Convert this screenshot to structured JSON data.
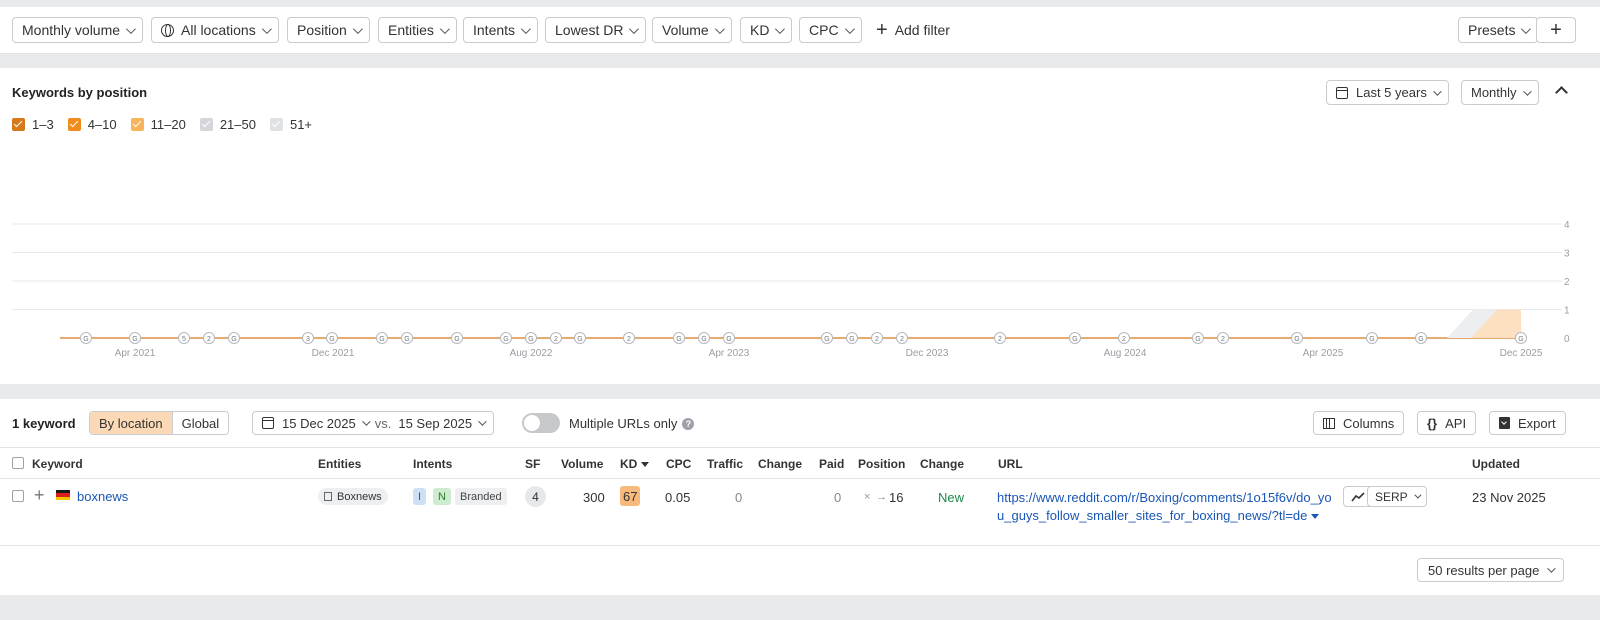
{
  "filters": {
    "items": [
      "Monthly volume",
      "All locations",
      "Position",
      "Entities",
      "Intents",
      "Lowest DR",
      "Volume",
      "KD",
      "CPC"
    ],
    "add_filter": "Add filter",
    "presets": "Presets"
  },
  "chart": {
    "title": "Keywords by position",
    "range_btn": "Last 5 years",
    "interval_btn": "Monthly",
    "legend": [
      {
        "label": "1–3",
        "color": "#d7791a",
        "checked": true
      },
      {
        "label": "4–10",
        "color": "#f08c1c",
        "checked": true
      },
      {
        "label": "11–20",
        "color": "#f8b45a",
        "checked": true
      },
      {
        "label": "21–50",
        "color": "#d4d6da",
        "checked": true
      },
      {
        "label": "51+",
        "color": "#dfe1e4",
        "checked": true
      }
    ]
  },
  "chart_data": {
    "type": "area",
    "x_ticks": [
      "Apr 2021",
      "Dec 2021",
      "Aug 2022",
      "Apr 2023",
      "Dec 2023",
      "Aug 2024",
      "Apr 2025",
      "Dec 2025"
    ],
    "y_ticks": [
      "4",
      "3",
      "2",
      "1",
      "0"
    ],
    "ylim": [
      0,
      4
    ],
    "series": [
      {
        "name": "1–3",
        "values": [
          0,
          0,
          0,
          0,
          0,
          0,
          0,
          0
        ]
      },
      {
        "name": "4–10",
        "values": [
          0,
          0,
          0,
          0,
          0,
          0,
          0,
          0
        ]
      },
      {
        "name": "11–20",
        "values": [
          0,
          0,
          0,
          0,
          0,
          0,
          0,
          1
        ]
      },
      {
        "name": "21–50",
        "values": [
          0,
          0,
          0,
          0,
          0,
          0,
          0,
          1
        ]
      },
      {
        "name": "51+",
        "values": [
          0,
          0,
          0,
          0,
          0,
          0,
          0,
          0
        ]
      }
    ],
    "annotations": [
      "G",
      "G",
      "5",
      "2",
      "G",
      "3",
      "G",
      "G",
      "G",
      "G",
      "G",
      "G",
      "2",
      "G",
      "2",
      "G",
      "G",
      "G",
      "G",
      "G",
      "2",
      "2",
      "2",
      "G",
      "2",
      "G",
      "2",
      "G",
      "G",
      "G",
      "G"
    ],
    "grid": true,
    "legend": "top-left"
  },
  "table": {
    "count": "1 keyword",
    "by_location": "By location",
    "global": "Global",
    "date_a": "15 Dec 2025",
    "vs": "vs.",
    "date_b": "15 Sep 2025",
    "multiple_urls": "Multiple URLs only",
    "columns_btn": "Columns",
    "api_btn": "API",
    "export_btn": "Export",
    "headers": {
      "keyword": "Keyword",
      "entities": "Entities",
      "intents": "Intents",
      "sf": "SF",
      "volume": "Volume",
      "kd": "KD",
      "cpc": "CPC",
      "traffic": "Traffic",
      "change": "Change",
      "paid": "Paid",
      "position": "Position",
      "change2": "Change",
      "url": "URL",
      "updated": "Updated"
    },
    "row": {
      "keyword": "boxnews",
      "entity": "Boxnews",
      "intent_i": "I",
      "intent_n": "N",
      "intent_branded": "Branded",
      "sf": "4",
      "volume": "300",
      "kd": "67",
      "cpc": "0.05",
      "traffic": "0",
      "paid": "0",
      "position_prev": "×",
      "position_arrow": "→",
      "position": "16",
      "change": "New",
      "url": "https://www.reddit.com/r/Boxing/comments/1o15f6v/do_you_guys_follow_smaller_sites_for_boxing_news/?tl=de",
      "serp": "SERP",
      "updated": "23 Nov 2025"
    },
    "per_page": "50 results per page"
  },
  "colors": {
    "accent_orange": "#f08c1c",
    "link_blue": "#1a56b6",
    "new_green": "#1e8a4c"
  }
}
